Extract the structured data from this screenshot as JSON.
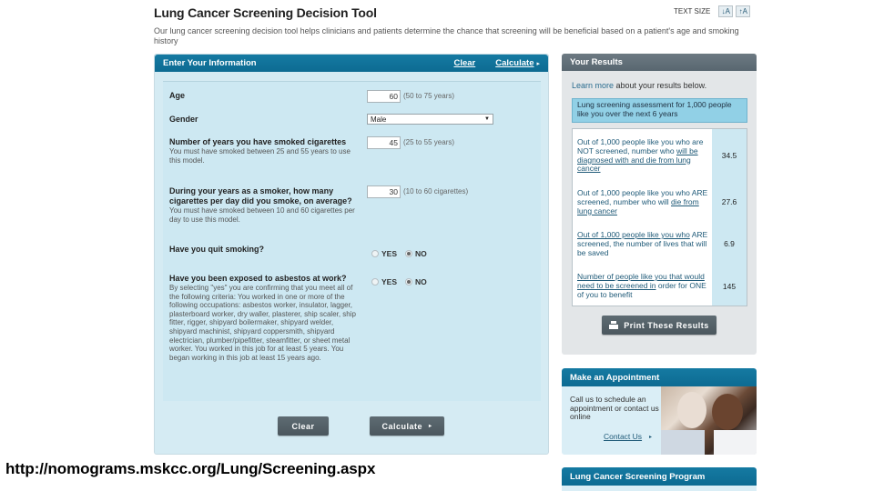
{
  "header": {
    "title": "Lung Cancer Screening Decision Tool",
    "text_size_label": "TEXT SIZE",
    "text_size_decrease": "↓A",
    "text_size_increase": "↑A",
    "intro": "Our lung cancer screening decision tool helps clinicians and patients determine the chance that screening will be beneficial based on a patient's age and smoking history"
  },
  "form": {
    "title": "Enter Your Information",
    "clear_link": "Clear",
    "calculate_link": "Calculate",
    "arrow_icon": "▸",
    "age": {
      "label": "Age",
      "value": "60",
      "range": "(50 to 75 years)"
    },
    "gender": {
      "label": "Gender",
      "value": "Male",
      "caret_icon": "▼"
    },
    "years_smoked": {
      "label": "Number of years you have smoked cigarettes",
      "help": "You must have smoked between 25 and 55 years to use this model.",
      "value": "45",
      "range": "(25 to 55 years)"
    },
    "cigs_per_day": {
      "label": "During your years as a smoker, how many cigarettes per day did you smoke, on average?",
      "help": "You must have smoked between 10 and 60 cigarettes per day to use this model.",
      "value": "30",
      "range": "(10 to 60 cigarettes)"
    },
    "quit": {
      "label": "Have you quit smoking?",
      "yes": "YES",
      "no": "NO",
      "selected": "NO"
    },
    "asbestos": {
      "label": "Have you been exposed to asbestos at work?",
      "help": "By selecting \"yes\" you are confirming that you meet all of the following criteria: You worked in one or more of the following occupations: asbestos worker, insulator, lagger, plasterboard worker, dry waller, plasterer, ship scaler, ship fitter, rigger, shipyard boilermaker, shipyard welder, shipyard machinist, shipyard coppersmith, shipyard electrician, plumber/pipefitter, steamfitter, or sheet metal worker. You worked in this job for at least 5 years. You began working in this job at least 15 years ago.",
      "yes": "YES",
      "no": "NO",
      "selected": "NO"
    },
    "clear_button": "Clear",
    "calculate_button": "Calculate"
  },
  "results": {
    "title": "Your Results",
    "learn_more_link": "Learn more",
    "learn_more_rest": " about your results below.",
    "assessment_caption": "Lung screening assessment for 1,000 people like you over the next 6 years",
    "rows": [
      {
        "text_plain": "Out of 1,000 people like you who are NOT screened, number who ",
        "text_link": "will be diagnosed with and die from lung cancer",
        "value": "34.5"
      },
      {
        "text_plain": "Out of 1,000 people like you who ARE screened, number who will ",
        "text_link": "die from lung cancer",
        "value": "27.6"
      },
      {
        "text_link": "Out of 1,000 people like you who",
        "text_plain": " ARE screened, the number of lives that will be saved",
        "value": "6.9"
      },
      {
        "text_link": "Number of people like you that would need to be screened in",
        "text_plain": " order for ONE of you to benefit",
        "value": "145"
      }
    ],
    "print_button": "Print These Results"
  },
  "appointment": {
    "title": "Make an Appointment",
    "text": "Call us to schedule an appointment or contact us online",
    "contact_link": "Contact Us",
    "arrow_icon": "▸"
  },
  "program": {
    "title": "Lung Cancer Screening Program"
  },
  "caption": {
    "url": "http://nomograms.mskcc.org/Lung/Screening.aspx"
  }
}
